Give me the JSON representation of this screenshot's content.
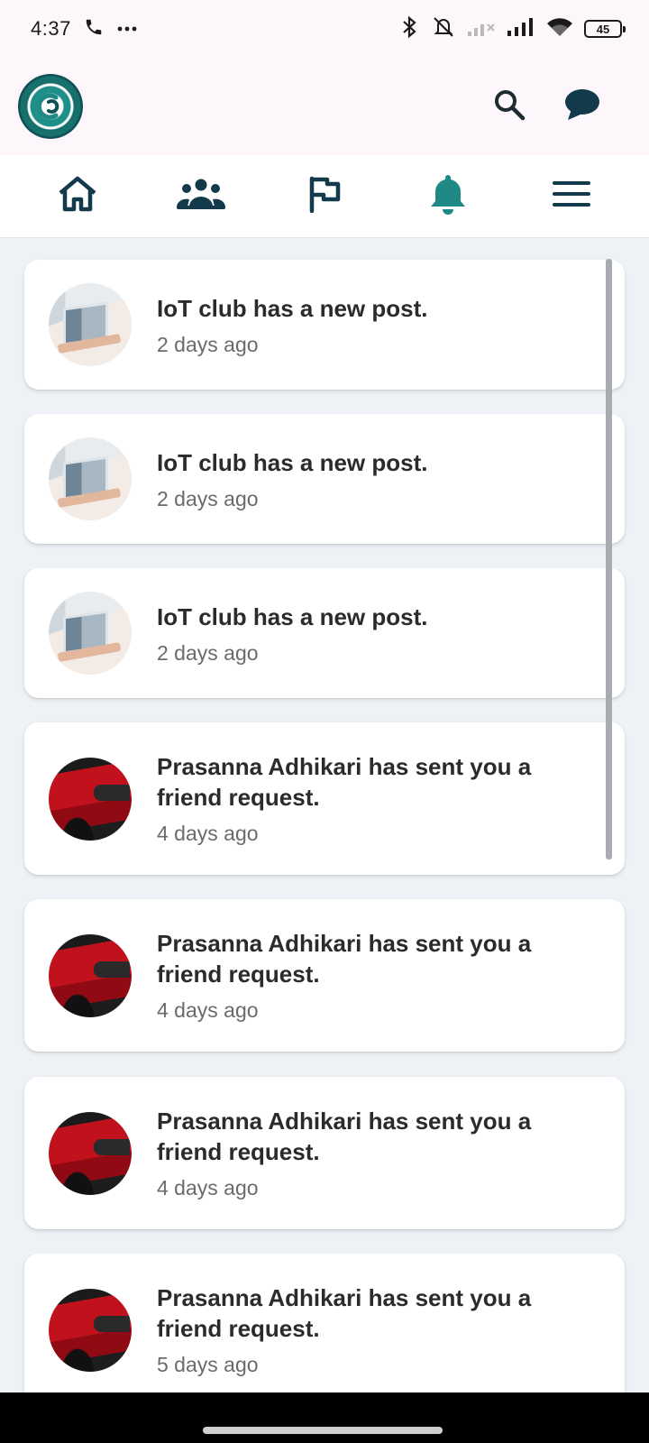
{
  "status_bar": {
    "time": "4:37",
    "battery_level": "45",
    "icons": [
      "phone-icon",
      "more-dots-icon",
      "bluetooth-icon",
      "bell-off-icon",
      "signal-weak-icon",
      "signal-icon",
      "wifi-icon",
      "battery-icon"
    ]
  },
  "header": {
    "logo_icon": "club-logo",
    "actions": [
      "search-icon",
      "chat-bubble-icon"
    ]
  },
  "nav": {
    "items": [
      {
        "icon": "home-icon",
        "active": false
      },
      {
        "icon": "people-icon",
        "active": false
      },
      {
        "icon": "flag-icon",
        "active": false
      },
      {
        "icon": "bell-icon",
        "active": true
      },
      {
        "icon": "menu-icon",
        "active": false
      }
    ],
    "active_color": "#1f8a85",
    "icon_color": "#123a4a"
  },
  "notifications": [
    {
      "avatar": "laptop-photo",
      "message": "IoT club has a new post.",
      "time": "2 days ago"
    },
    {
      "avatar": "laptop-photo",
      "message": "IoT club has a new post.",
      "time": "2 days ago"
    },
    {
      "avatar": "laptop-photo",
      "message": "IoT club has a new post.",
      "time": "2 days ago"
    },
    {
      "avatar": "red-car-photo",
      "message": "Prasanna Adhikari has sent you a friend request.",
      "time": "4 days ago"
    },
    {
      "avatar": "red-car-photo",
      "message": "Prasanna Adhikari has sent you a friend request.",
      "time": "4 days ago"
    },
    {
      "avatar": "red-car-photo",
      "message": "Prasanna Adhikari has sent you a friend request.",
      "time": "4 days ago"
    },
    {
      "avatar": "red-car-photo",
      "message": "Prasanna Adhikari has sent you a friend request.",
      "time": "5 days ago"
    }
  ]
}
